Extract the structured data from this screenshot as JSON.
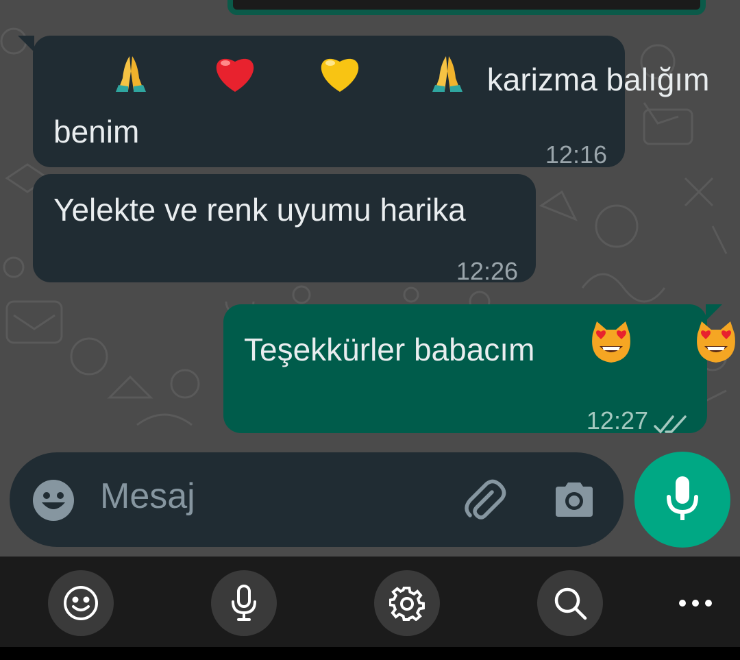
{
  "messages": [
    {
      "direction": "incoming",
      "text_line1": "karizma balığım",
      "text_line2": "benim",
      "emojis": [
        "folded-hands",
        "red-heart",
        "yellow-heart",
        "folded-hands"
      ],
      "time": "12:16"
    },
    {
      "direction": "incoming",
      "text": "Yelekte ve renk uyumu harika",
      "time": "12:26"
    },
    {
      "direction": "outgoing",
      "text": "Teşekkürler babacım",
      "emojis": [
        "heart-eyes-cat",
        "heart-eyes-cat"
      ],
      "time": "12:27",
      "status": "read"
    }
  ],
  "composer": {
    "placeholder": "Mesaj"
  },
  "keyboard_toolbar": [
    "emoji",
    "voice",
    "settings",
    "search",
    "more"
  ],
  "colors": {
    "background": "#4b4b4b",
    "incoming_bubble": "#202c33",
    "outgoing_bubble": "#005c4b",
    "accent": "#00a884",
    "text": "#e9edef",
    "meta": "#9aa5ab"
  }
}
